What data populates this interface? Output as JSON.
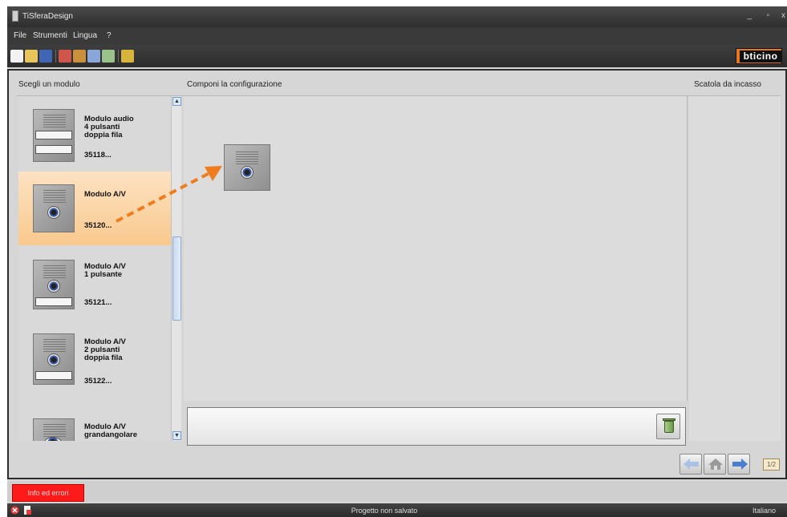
{
  "window": {
    "title": "TiSferaDesign"
  },
  "menu": [
    "File",
    "Strumenti",
    "Lingua",
    "?"
  ],
  "toolbar": {
    "buttons": [
      "new-file-icon",
      "open-folder-icon",
      "save-icon",
      "import-icon",
      "export-icon",
      "tool-icon",
      "settings-icon",
      "view-options-icon"
    ],
    "logo": "bticino",
    "brand_color": "#e87722"
  },
  "headers": {
    "modules": "Scegli un modulo",
    "compose": "Componi la configurazione",
    "box": "Scatola da incasso"
  },
  "modules": [
    {
      "name_lines": [
        "Modulo audio",
        "4 pulsanti",
        "doppia fila"
      ],
      "code": "35118...",
      "selected": false
    },
    {
      "name_lines": [
        "Modulo A/V"
      ],
      "code": "35120...",
      "selected": true
    },
    {
      "name_lines": [
        "Modulo A/V",
        "1 pulsante"
      ],
      "code": "35121...",
      "selected": false
    },
    {
      "name_lines": [
        "Modulo A/V",
        "2 pulsanti",
        "doppia fila"
      ],
      "code": "35122...",
      "selected": false
    },
    {
      "name_lines": [
        "Modulo A/V",
        "grandangolare"
      ],
      "code": "",
      "selected": false
    }
  ],
  "navigation": {
    "page": "1/2"
  },
  "errors": {
    "label": "Info ed errori"
  },
  "status": {
    "text": "Progetto non salvato",
    "language": "Italiano"
  },
  "colors": {
    "selection": "#f9c98e",
    "error": "#ff1a1a",
    "drag_arrow": "#ef7c1e",
    "nav_arrow": "#4a7fd0"
  }
}
